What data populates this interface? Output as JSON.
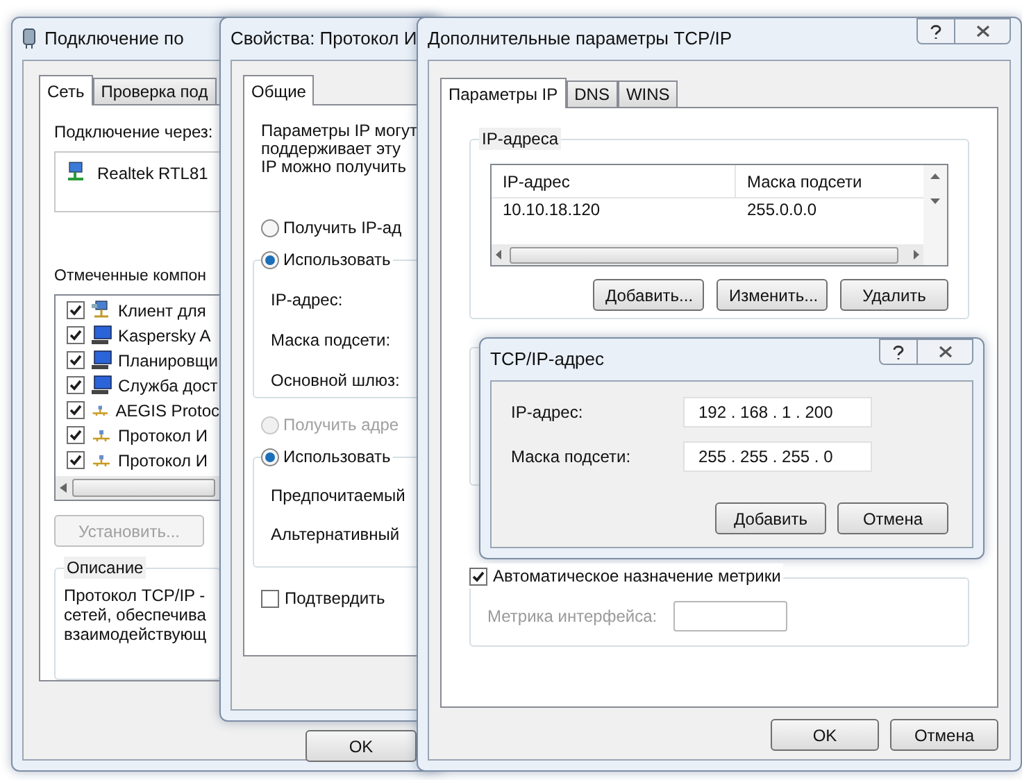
{
  "connection_window": {
    "title": "Подключение по",
    "tabs": [
      {
        "label": "Сеть",
        "selected": true
      },
      {
        "label": "Проверка под",
        "selected": false
      }
    ],
    "connect_via_label": "Подключение через:",
    "adapter": "Realtek RTL81",
    "components_label": "Отмеченные компон",
    "components": [
      {
        "label": "Клиент для",
        "checked": true,
        "kind": "client"
      },
      {
        "label": "Kaspersky A",
        "checked": true,
        "kind": "service"
      },
      {
        "label": "Планировщи",
        "checked": true,
        "kind": "service"
      },
      {
        "label": "Служба дост",
        "checked": true,
        "kind": "service"
      },
      {
        "label": "AEGIS Protoc",
        "checked": true,
        "kind": "protocol"
      },
      {
        "label": "Протокол И",
        "checked": true,
        "kind": "protocol"
      },
      {
        "label": "Протокол И",
        "checked": true,
        "kind": "protocol"
      }
    ],
    "install_button": {
      "label": "Установить...",
      "disabled": true
    },
    "description": {
      "legend": "Описание",
      "lines": [
        "Протокол TCP/IP -",
        "сетей, обеспечива",
        "взаимодействующ"
      ]
    },
    "ok_button": "OK"
  },
  "ipv4_window": {
    "title": "Свойства: Протокол И",
    "tabs": [
      {
        "label": "Общие",
        "selected": true
      }
    ],
    "intro_lines": [
      "Параметры IP могут",
      "поддерживает эту",
      "IP можно получить"
    ],
    "ip_radios": [
      {
        "label": "Получить IP-ад",
        "selected": false,
        "disabled": false
      },
      {
        "label": "Использовать",
        "selected": true,
        "disabled": false
      }
    ],
    "ip_fields": [
      "IP-адрес:",
      "Маска подсети:",
      "Основной шлюз:"
    ],
    "dns_radios": [
      {
        "label": "Получить адре",
        "selected": false,
        "disabled": true
      },
      {
        "label": "Использовать",
        "selected": true,
        "disabled": false
      }
    ],
    "dns_fields": [
      "Предпочитаемый",
      "Альтернативный"
    ],
    "validate": {
      "label": "Подтвердить",
      "checked": false
    }
  },
  "advanced_window": {
    "title": "Дополнительные параметры TCP/IP",
    "tabs": [
      {
        "label": "Параметры IP",
        "selected": true
      },
      {
        "label": "DNS",
        "selected": false
      },
      {
        "label": "WINS",
        "selected": false
      }
    ],
    "ip_group": {
      "legend": "IP-адреса",
      "columns": [
        "IP-адрес",
        "Маска подсети"
      ],
      "rows": [
        [
          "10.10.18.120",
          "255.0.0.0"
        ]
      ],
      "buttons": [
        "Добавить...",
        "Изменить...",
        "Удалить"
      ]
    },
    "auto_metric": {
      "label": "Автоматическое назначение метрики",
      "checked": true
    },
    "metric": {
      "label": "Метрика интерфейса:",
      "disabled": true
    },
    "buttons": [
      "OK",
      "Отмена"
    ]
  },
  "address_dialog": {
    "title": "TCP/IP-адрес",
    "fields": [
      {
        "label": "IP-адрес:",
        "value": "192 . 168 . 1 . 200"
      },
      {
        "label": "Маска подсети:",
        "value": "255 . 255 . 255 . 0"
      }
    ],
    "buttons": [
      "Добавить",
      "Отмена"
    ]
  }
}
